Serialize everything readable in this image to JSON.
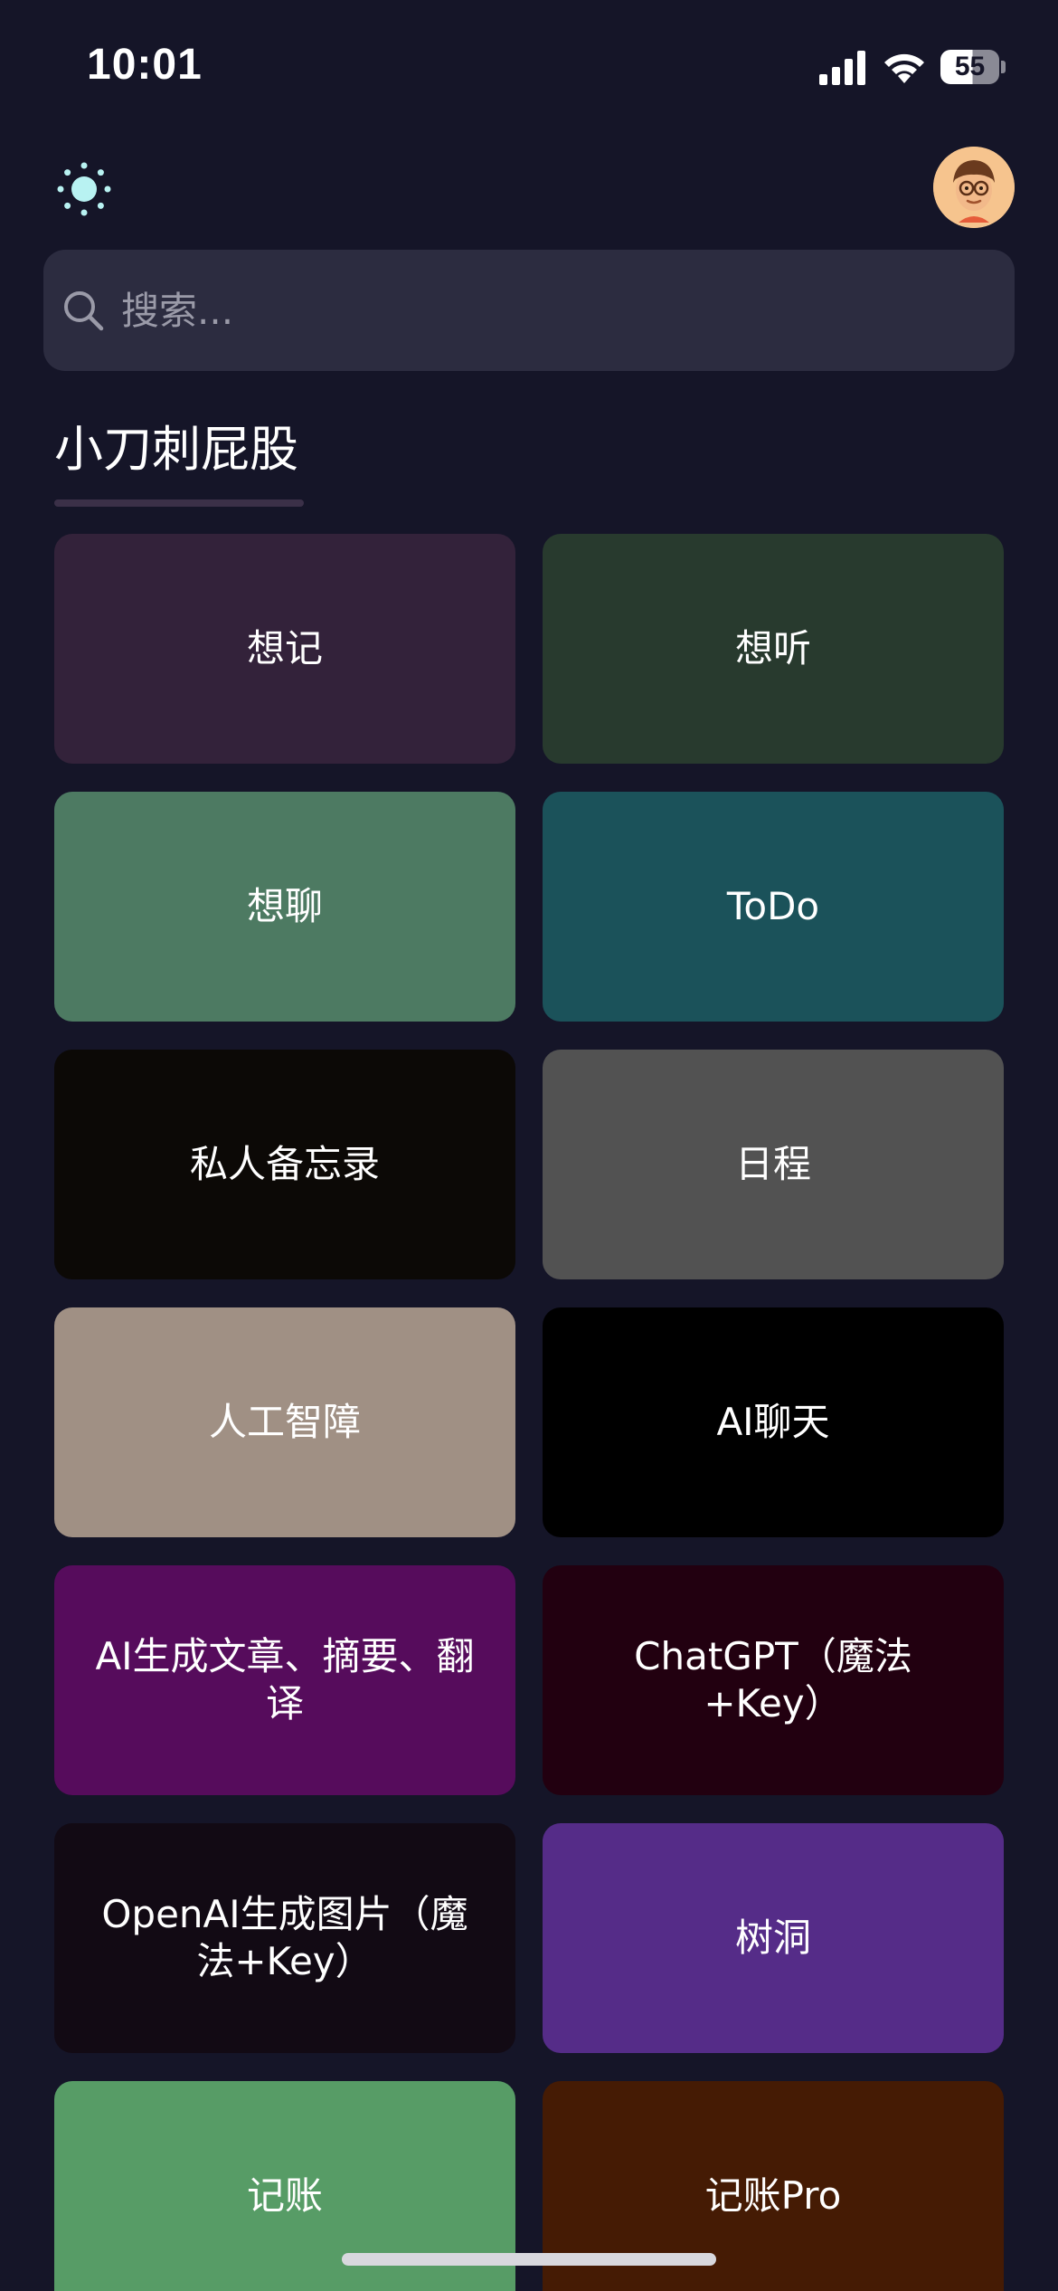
{
  "status_bar": {
    "time": "10:01",
    "battery_level": "55",
    "battery_fraction": 0.55
  },
  "header": {
    "theme_icon": "sun-icon",
    "avatar_icon": "memoji-avatar-icon"
  },
  "search": {
    "placeholder": "搜索...",
    "value": ""
  },
  "section": {
    "title": "小刀刺屁股"
  },
  "tiles": [
    {
      "label": "想记",
      "color": "#33223a"
    },
    {
      "label": "想听",
      "color": "#283a2e"
    },
    {
      "label": "想聊",
      "color": "#4d7a62"
    },
    {
      "label": "ToDo",
      "color": "#1b525a"
    },
    {
      "label": "私人备忘录",
      "color": "#0c0906"
    },
    {
      "label": "日程",
      "color": "#525252"
    },
    {
      "label": "人工智障",
      "color": "#a09084"
    },
    {
      "label": "AI聊天",
      "color": "#000000"
    },
    {
      "label": "AI生成文章、摘要、翻译",
      "color": "#560c5c"
    },
    {
      "label": "ChatGPT（魔法+Key）",
      "color": "#220010"
    },
    {
      "label": "OpenAI生成图片（魔法+Key）",
      "color": "#120a14"
    },
    {
      "label": "树洞",
      "color": "#552c88"
    },
    {
      "label": "记账",
      "color": "#579c66"
    },
    {
      "label": "记账Pro",
      "color": "#451b04"
    }
  ]
}
